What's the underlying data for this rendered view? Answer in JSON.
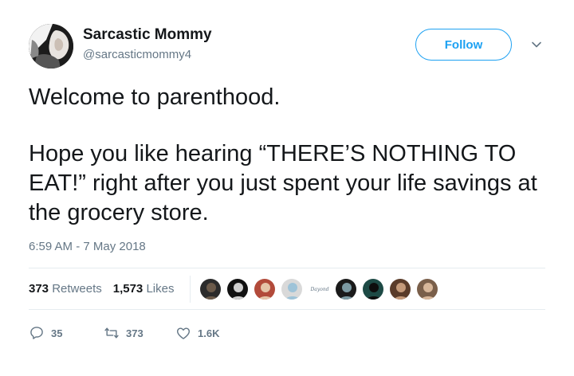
{
  "header": {
    "display_name": "Sarcastic Mommy",
    "handle": "@sarcasticmommy4",
    "follow_label": "Follow",
    "caret_icon": "chevron-down-icon"
  },
  "tweet": {
    "paragraphs": [
      "Welcome to parenthood.",
      "Hope you like hearing “THERE’S NOTHING TO EAT!” right after you just spent your life savings at the grocery store."
    ],
    "timestamp": "6:59 AM - 7 May 2018"
  },
  "stats": {
    "retweets_count": "373",
    "retweets_label": "Retweets",
    "likes_count": "1,573",
    "likes_label": "Likes"
  },
  "likers": [
    {
      "name": "liker-avatar-1",
      "colors": [
        "#2b2b2b",
        "#6b5a4a"
      ]
    },
    {
      "name": "liker-avatar-2",
      "colors": [
        "#111111",
        "#cfcfcf"
      ]
    },
    {
      "name": "liker-avatar-3",
      "colors": [
        "#b24a3a",
        "#e5c4a8"
      ]
    },
    {
      "name": "liker-avatar-4",
      "colors": [
        "#d9d9d9",
        "#9ec3d8"
      ]
    },
    {
      "name": "liker-avatar-5",
      "text": "Dayond"
    },
    {
      "name": "liker-avatar-6",
      "colors": [
        "#1a1a1a",
        "#7c9aa3"
      ]
    },
    {
      "name": "liker-avatar-7",
      "colors": [
        "#1d4a45",
        "#0d0d0d"
      ]
    },
    {
      "name": "liker-avatar-8",
      "colors": [
        "#5a3c2a",
        "#c49a7a"
      ]
    },
    {
      "name": "liker-avatar-9",
      "colors": [
        "#7a5f4a",
        "#d8b79a"
      ]
    }
  ],
  "actions": {
    "replies": "35",
    "retweets": "373",
    "likes": "1.6K"
  },
  "colors": {
    "accent": "#1da1f2",
    "secondary_text": "#657786",
    "primary_text": "#14171a",
    "divider": "#e6ecf0"
  }
}
